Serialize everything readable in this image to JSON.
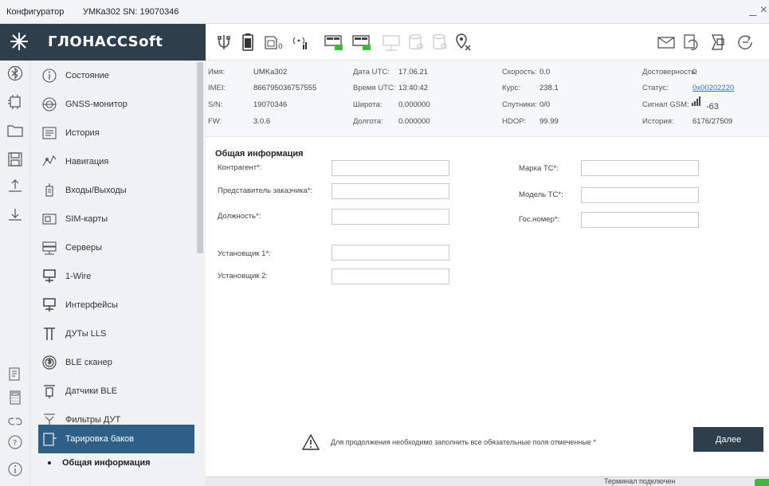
{
  "titlebar": {
    "app_title": "Конфигуратор",
    "device_title": "УМКа302 SN: 19070346",
    "window_controls": "_ ×"
  },
  "brand": {
    "logo": "ГЛОНАССSoft"
  },
  "toolbar_icons": [
    "usb-icon",
    "battery-icon",
    "sim-icon",
    "gsm-antenna-icon",
    "device-green-icon",
    "device-green-2-icon",
    "device-disabled-icon",
    "storage-disabled-icon",
    "storage-disabled-2-icon",
    "location-off-icon",
    "mail-icon",
    "refresh-icon",
    "firmware-icon",
    "back-icon"
  ],
  "rail_icons": [
    "bluetooth-icon",
    "chip-icon",
    "folder-icon",
    "save-icon",
    "upload-icon",
    "download-icon",
    "log-icon",
    "calculator-icon",
    "link-icon",
    "help-icon",
    "info-icon"
  ],
  "nav": {
    "items": [
      {
        "label": "Состояние",
        "icon": "info-circle-icon"
      },
      {
        "label": "GNSS-монитор",
        "icon": "satellite-icon"
      },
      {
        "label": "История",
        "icon": "history-icon"
      },
      {
        "label": "Навигация",
        "icon": "navigation-icon"
      },
      {
        "label": "Входы/Выходы",
        "icon": "io-icon"
      },
      {
        "label": "SIM-карты",
        "icon": "sim-card-icon"
      },
      {
        "label": "Серверы",
        "icon": "server-icon"
      },
      {
        "label": "1-Wire",
        "icon": "one-wire-icon"
      },
      {
        "label": "Интерфейсы",
        "icon": "interfaces-icon"
      },
      {
        "label": "ДУТы LLS",
        "icon": "fuel-sensor-icon"
      },
      {
        "label": "BLE сканер",
        "icon": "ble-scanner-icon"
      },
      {
        "label": "Датчики BLE",
        "icon": "ble-sensor-icon"
      },
      {
        "label": "Фильтры ДУТ",
        "icon": "filter-icon"
      },
      {
        "label": "Тарировка баков",
        "icon": "tank-icon"
      }
    ],
    "sub_item": "Общая информация"
  },
  "status": {
    "name_label": "Имя:",
    "name_value": "UMKa302",
    "imei_label": "IMEI:",
    "imei_value": "866795036757555",
    "sn_label": "S/N:",
    "sn_value": "19070346",
    "fw_label": "FW:",
    "fw_value": "3.0.6",
    "date_label": "Дата UTC:",
    "date_value": "17.06.21",
    "time_label": "Время UTC:",
    "time_value": "13:40:42",
    "lat_label": "Широта:",
    "lat_value": "0.000000",
    "lon_label": "Долгота:",
    "lon_value": "0.000000",
    "speed_label": "Скорость:",
    "speed_value": "0.0",
    "course_label": "Курс:",
    "course_value": "238.1",
    "sats_label": "Спутники:",
    "sats_value": "0/0",
    "hdop_label": "HDOP:",
    "hdop_value": "99.99",
    "valid_label": "Достоверность:",
    "valid_value": "0",
    "state_label": "Статус:",
    "state_value": "0x00202220",
    "gsm_label": "Сигнал GSM:",
    "gsm_value": "-63",
    "history_label": "История:",
    "history_value": "6176/27509"
  },
  "form": {
    "section_title": "Общая информация",
    "left": [
      {
        "label": "Контрагент*:",
        "value": ""
      },
      {
        "label": "Представитель заказчика*:",
        "value": ""
      },
      {
        "label": "Должность*:",
        "value": ""
      },
      {
        "label": "Установщик 1*:",
        "value": ""
      },
      {
        "label": "Установщик 2:",
        "value": ""
      }
    ],
    "right": [
      {
        "label": "Марка ТС*:",
        "value": ""
      },
      {
        "label": "Модель ТС*:",
        "value": ""
      },
      {
        "label": "Гос.номер*:",
        "value": ""
      }
    ]
  },
  "warning": "Для продолжения необходимо заполнить все обязательные поля отмеченные *",
  "next_button": "Далее",
  "statusbar": {
    "connection": "Терминал подключен"
  },
  "colors": {
    "brand_dark": "#2e3e4a",
    "nav_active": "#2e5f86",
    "accent_green": "#3cb93c",
    "link": "#3a70c0"
  }
}
